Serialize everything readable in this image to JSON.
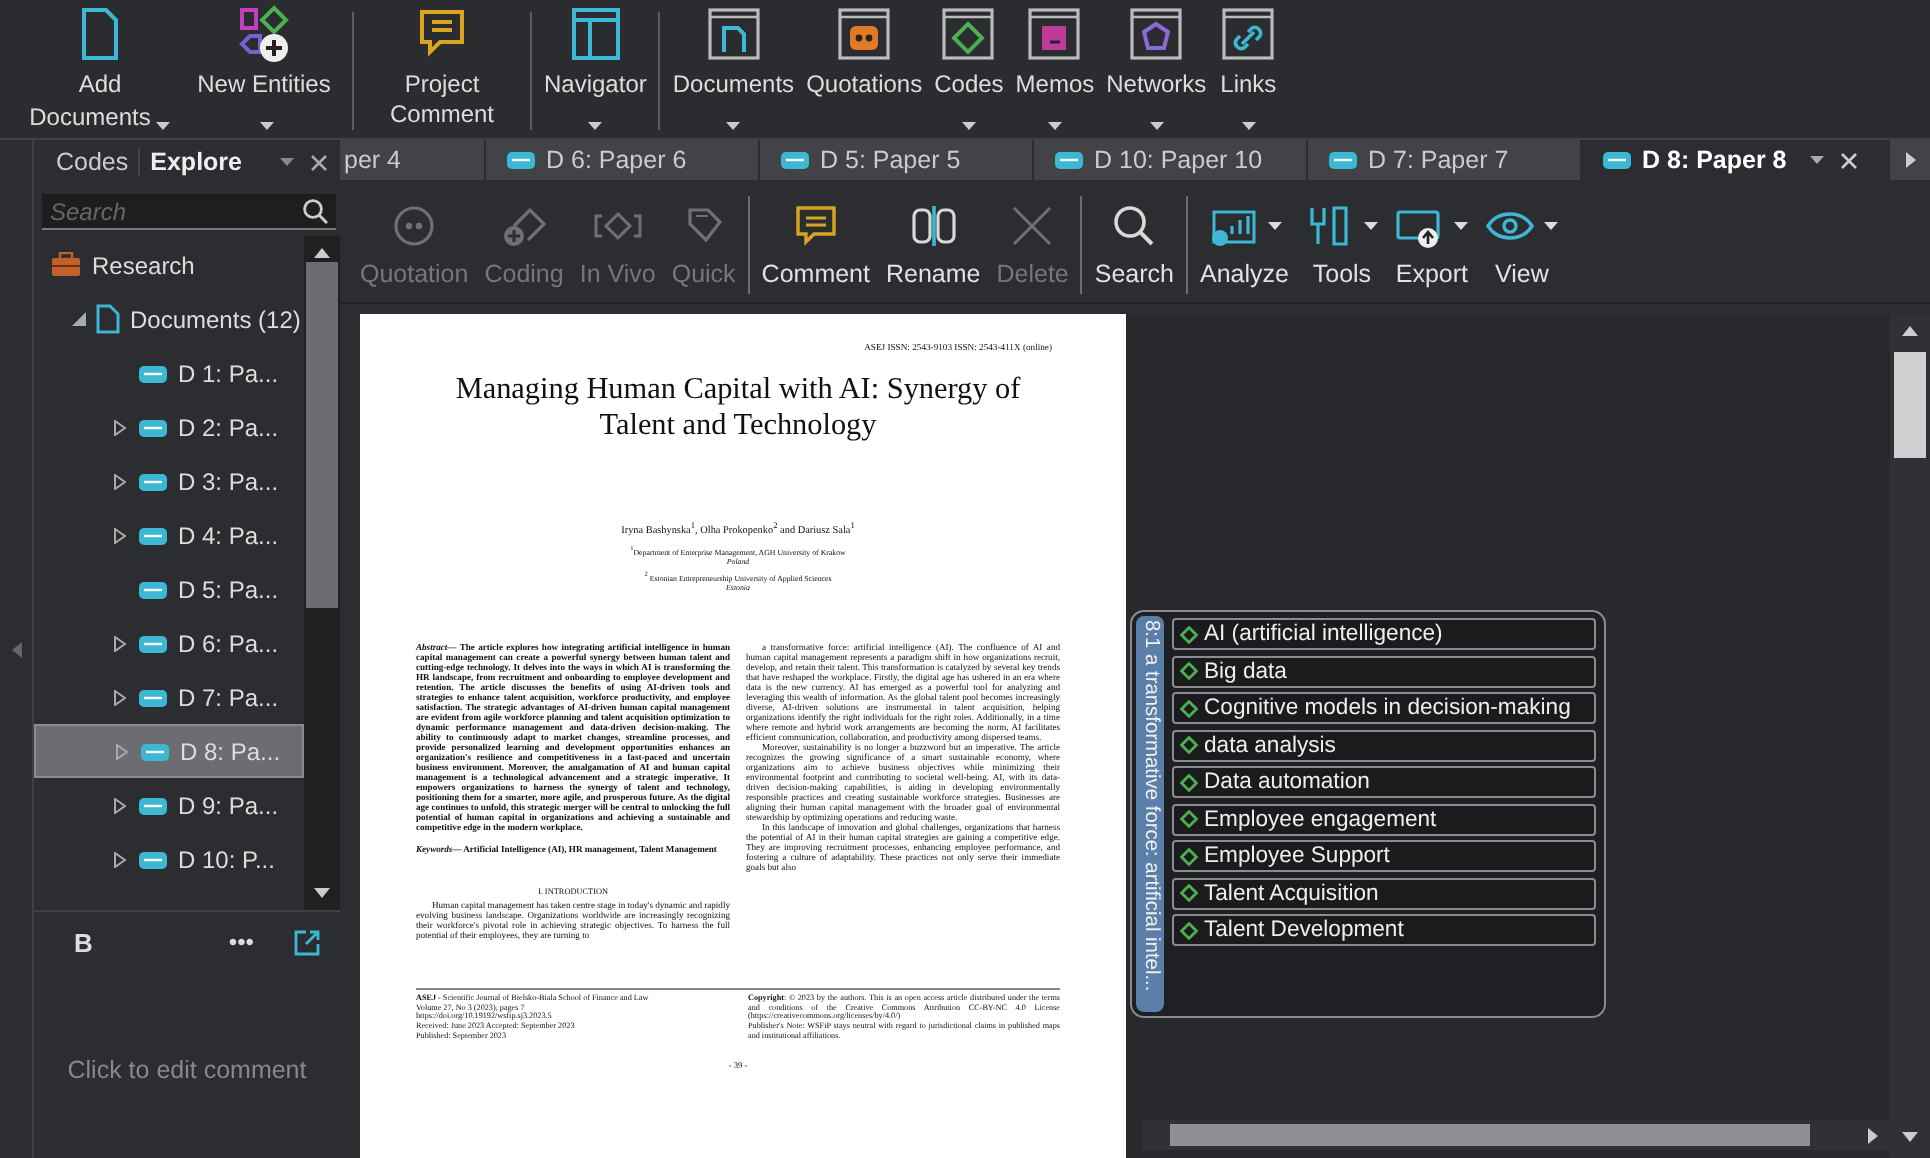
{
  "ribbon": {
    "groups": [
      [
        {
          "label": "Add Documents",
          "dropdown": true
        },
        {
          "label": "New Entities",
          "dropdown": true
        }
      ],
      [
        {
          "label": "Project Comment",
          "dropdown": false
        }
      ],
      [
        {
          "label": "Navigator",
          "dropdown": true
        }
      ],
      [
        {
          "label": "Documents",
          "dropdown": true
        },
        {
          "label": "Quotations",
          "dropdown": false
        },
        {
          "label": "Codes",
          "dropdown": true
        },
        {
          "label": "Memos",
          "dropdown": true
        },
        {
          "label": "Networks",
          "dropdown": true
        },
        {
          "label": "Links",
          "dropdown": true
        }
      ]
    ]
  },
  "side_panel": {
    "tabs": [
      {
        "label": "Codes",
        "selected": false
      },
      {
        "label": "Explore",
        "selected": true
      }
    ],
    "search": {
      "placeholder": "Search"
    },
    "tree": [
      {
        "label": "Research",
        "selected": false,
        "children": [
          {
            "label": "Documents (12)",
            "selected": false,
            "expanded": true,
            "children": [
              {
                "label": "D 1: Pa...",
                "expandable": false,
                "selected": false
              },
              {
                "label": "D 2: Pa...",
                "expandable": true,
                "selected": false
              },
              {
                "label": "D 3: Pa...",
                "expandable": true,
                "selected": false
              },
              {
                "label": "D 4: Pa...",
                "expandable": true,
                "selected": false
              },
              {
                "label": "D 5: Pa...",
                "expandable": false,
                "selected": false
              },
              {
                "label": "D 6: Pa...",
                "expandable": true,
                "selected": false
              },
              {
                "label": "D 7: Pa...",
                "expandable": true,
                "selected": false
              },
              {
                "label": "D 8: Pa...",
                "expandable": true,
                "selected": true
              },
              {
                "label": "D 9: Pa...",
                "expandable": true,
                "selected": false
              },
              {
                "label": "D 10: P...",
                "expandable": true,
                "selected": false
              }
            ]
          }
        ]
      }
    ],
    "comment": {
      "bold_button": "B",
      "more_button": "•••",
      "placeholder": "Click to edit comment"
    }
  },
  "doc_tabs": [
    {
      "label": "per 4",
      "cut": true,
      "selected": false
    },
    {
      "label": "D 6: Paper 6",
      "cut": false,
      "selected": false
    },
    {
      "label": "D 5: Paper 5",
      "cut": false,
      "selected": false
    },
    {
      "label": "D 10: Paper 10",
      "cut": false,
      "selected": false
    },
    {
      "label": "D 7: Paper 7",
      "cut": false,
      "selected": false
    },
    {
      "label": "D 8: Paper 8",
      "cut": false,
      "selected": true
    }
  ],
  "toolbar": {
    "groups": [
      [
        {
          "label": "Quotation",
          "disabled": true,
          "dropdown": false
        },
        {
          "label": "Coding",
          "disabled": true,
          "dropdown": false
        },
        {
          "label": "In Vivo",
          "disabled": true,
          "dropdown": false
        },
        {
          "label": "Quick",
          "disabled": true,
          "dropdown": false
        }
      ],
      [
        {
          "label": "Comment",
          "disabled": false,
          "dropdown": false
        },
        {
          "label": "Rename",
          "disabled": false,
          "dropdown": false
        },
        {
          "label": "Delete",
          "disabled": true,
          "dropdown": false
        }
      ],
      [
        {
          "label": "Search",
          "disabled": false,
          "dropdown": false
        }
      ],
      [
        {
          "label": "Analyze",
          "disabled": false,
          "dropdown": true
        },
        {
          "label": "Tools",
          "disabled": false,
          "dropdown": true
        },
        {
          "label": "Export",
          "disabled": false,
          "dropdown": true
        },
        {
          "label": "View",
          "disabled": false,
          "dropdown": true
        }
      ]
    ]
  },
  "document": {
    "header": "ASEJ ISSN: 2543-9103  ISSN: 2543-411X (online)",
    "title": "Managing Human Capital with AI: Synergy of Talent and Technology",
    "authors": "Iryna Bashynska$^{1}$, Olha Prokopenko$^{2}$ and Dariusz Sala$^{1}$",
    "affiliations": [
      {
        "name": "$^{1}$Department of Enterprise Management, AGH University of Krakow",
        "country": "Poland"
      },
      {
        "name": "$^{2}$ Estonian Entrepreneurship University of Applied Sciences",
        "country": "Estonia"
      }
    ],
    "abstract": "*Abstract*— The article explores how integrating artificial intelligence in human capital management can create a powerful synergy between human talent and cutting-edge technology. It delves into the ways in which AI is transforming the HR landscape, from recruitment and onboarding to employee development and retention. The article discusses the benefits of using AI-driven tools and strategies to enhance talent acquisition, workforce productivity, and employee satisfaction. The strategic advantages of AI-driven human capital management are evident from agile workforce planning and talent acquisition optimization to dynamic performance management and data-driven decision-making. The ability to continuously adapt to market changes, streamline processes, and provide personalized learning and development opportunities enhances an organization's resilience and competitiveness in a fast-paced and uncertain business environment. Moreover, the amalgamation of AI and human capital management is a technological advancement and a strategic imperative. It empowers organizations to harness the synergy of talent and technology, positioning them for a smarter, more agile, and prosperous future. As the digital age continues to unfold, this strategic merger will be central to unlocking the full potential of human capital in organizations and achieving a sustainable and competitive edge in the modern workplace.",
    "keywords": "*Keywords*— Artificial Intelligence (AI), HR management, Talent Management",
    "section_heading": "I. INTRODUCTION",
    "left_paragraphs": [
      "Human capital management has taken centre stage in today's dynamic and rapidly evolving business landscape. Organizations worldwide are increasingly recognizing their workforce's pivotal role in achieving strategic objectives. To harness the full potential of their employees, they are turning to"
    ],
    "right_paragraphs": [
      "a transformative force: artificial intelligence (AI). The confluence of AI and human capital management represents a paradigm shift in how organizations recruit, develop, and retain their talent. This transformation is catalyzed by several key trends that have reshaped the workplace. Firstly, the digital age has ushered in an era where data is the new currency. AI has emerged as a powerful tool for analyzing and leveraging this wealth of information. As the global talent pool becomes increasingly diverse, AI-driven solutions are instrumental in talent acquisition, helping organizations identify the right individuals for the right roles. Additionally, in a time where remote and hybrid work arrangements are becoming the norm, AI facilitates efficient communication, collaboration, and productivity among dispersed teams.",
      "Moreover, sustainability is no longer a buzzword but an imperative. The article recognizes the growing significance of a smart sustainable economy, where organizations aim to achieve business objectives while minimizing their environmental footprint and contributing to societal well-being. AI, with its data-driven decision-making capabilities, is aiding in developing environmentally responsible practices and creating sustainable workforce strategies. Businesses are aligning their human capital management with the broader goal of environmental stewardship by optimizing operations and reducing waste.",
      "In this landscape of innovation and global challenges, organizations that harness the potential of AI in their human capital strategies are gaining a competitive edge. They are improving recruitment processes, enhancing employee performance, and fostering a culture of adaptability. These practices not only serve their immediate goals but also"
    ],
    "footer_left": [
      "**ASEJ** - Scientific Journal of Bielsko-Biala School of Finance and Law",
      "Volume 27, No 3 (2023), pages 7",
      "https://doi.org/10.19192/wsfip.sj3.2023.5",
      "Received: June 2023  Accepted: September 2023",
      "Published: September 2023"
    ],
    "footer_right": [
      "**Copyright**: © 2023 by the authors. This is an open access article distributed under the terms and conditions of the Creative Commons Attribution CC-BY-NC 4.0 License (https://creativecommons.org/licenses/by/4.0/)",
      "Publisher's Note: WSFiP stays neutral with regard to jurisdictional claims in published maps and institutional affiliations."
    ],
    "page_number": "- 39 -"
  },
  "margin": {
    "quotation_label": "8:1 a transformative force: artificial intel...",
    "codes": [
      {
        "label": "AI (artificial intelligence)"
      },
      {
        "label": "Big data"
      },
      {
        "label": "Cognitive models in decision-making"
      },
      {
        "label": "data analysis"
      },
      {
        "label": "Data automation"
      },
      {
        "label": "Employee engagement"
      },
      {
        "label": "Employee Support"
      },
      {
        "label": "Talent Acquisition"
      },
      {
        "label": "Talent Development"
      }
    ]
  }
}
